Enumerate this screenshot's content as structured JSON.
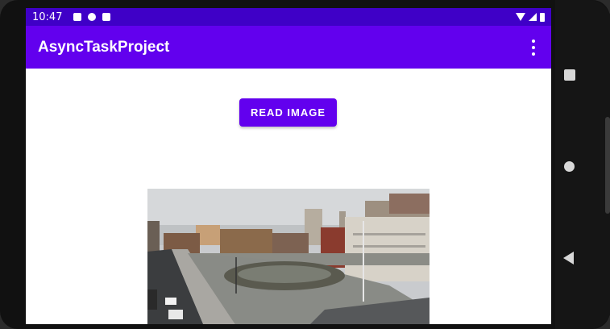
{
  "status_bar": {
    "time": "10:47",
    "left_icons": [
      "a-icon",
      "p-icon",
      "sd-card-icon"
    ],
    "right_icons": [
      "wifi-icon",
      "signal-icon",
      "battery-icon"
    ]
  },
  "app_bar": {
    "title": "AsyncTaskProject",
    "menu_icon": "more-vert-icon"
  },
  "main": {
    "read_button_label": "READ IMAGE",
    "image": "city-street-photo"
  },
  "nav_bar": {
    "icons": [
      "recents-icon",
      "home-icon",
      "back-icon"
    ]
  },
  "colors": {
    "status_bar": "#3f00c7",
    "primary": "#6200ee",
    "background": "#ffffff"
  }
}
